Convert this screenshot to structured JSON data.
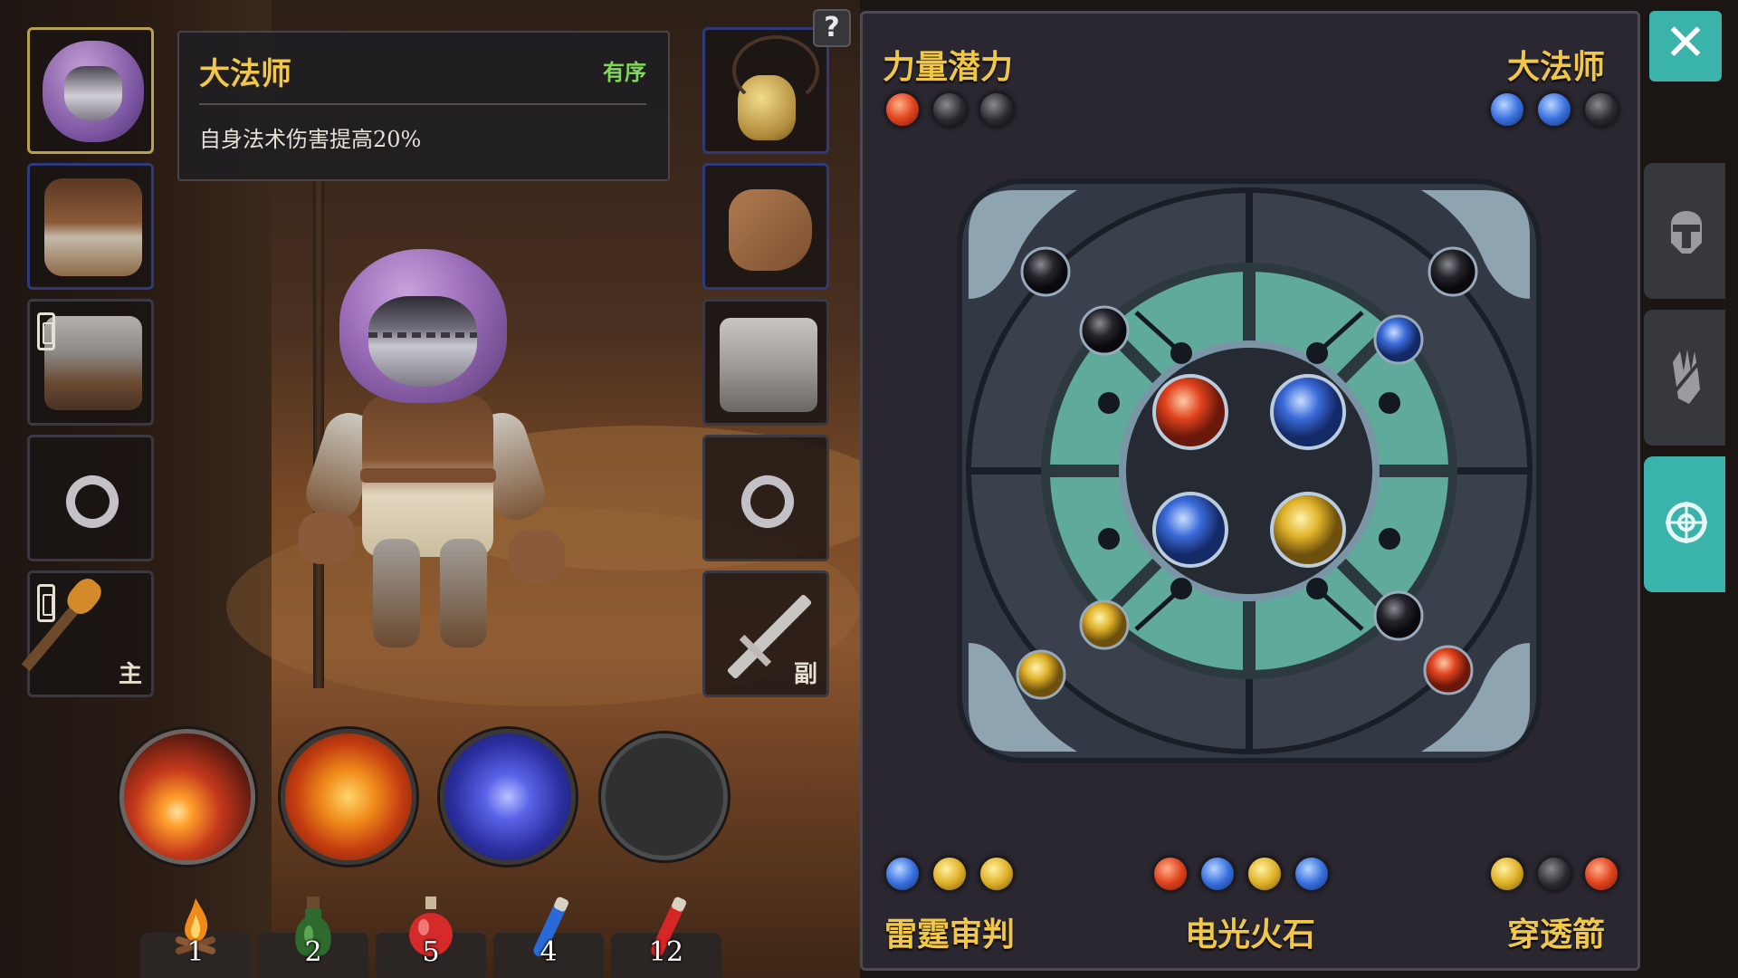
{
  "tooltip": {
    "title": "大法师",
    "tag": "有序",
    "description": "自身法术伤害提高20%"
  },
  "help": {
    "label": "?"
  },
  "equipment": {
    "left": [
      {
        "name": "hood",
        "mark": ""
      },
      {
        "name": "armor",
        "mark": ""
      },
      {
        "name": "leggings",
        "mark": ""
      },
      {
        "name": "ring",
        "mark": ""
      },
      {
        "name": "torch-weapon",
        "mark": "主"
      }
    ],
    "right": [
      {
        "name": "amulet",
        "mark": ""
      },
      {
        "name": "gloves",
        "mark": ""
      },
      {
        "name": "boots",
        "mark": ""
      },
      {
        "name": "ring",
        "mark": ""
      },
      {
        "name": "sword",
        "mark": "副"
      }
    ]
  },
  "skills": [
    "meteor-icon",
    "fire-burst-icon",
    "lightning-orb-icon",
    "empty-skill-slot"
  ],
  "consumables": [
    {
      "icon": "campfire-icon",
      "count": "1"
    },
    {
      "icon": "green-potion-icon",
      "count": "2"
    },
    {
      "icon": "red-potion-icon",
      "count": "5"
    },
    {
      "icon": "blue-vial-icon",
      "count": "4"
    },
    {
      "icon": "red-vial-icon",
      "count": "12"
    }
  ],
  "panel": {
    "title_left": "力量潜力",
    "title_right": "大法师",
    "top_left_gems": [
      "red",
      "black",
      "black"
    ],
    "top_right_gems": [
      "blue",
      "blue",
      "black"
    ],
    "footer": [
      {
        "title": "雷霆审判",
        "gems": [
          "blue",
          "gold",
          "gold"
        ]
      },
      {
        "title": "电光火石",
        "gems": [
          "red",
          "blue",
          "gold",
          "blue"
        ]
      },
      {
        "title": "穿透箭",
        "gems": [
          "gold",
          "black",
          "red"
        ]
      }
    ]
  },
  "side_tabs": [
    "helmet-icon",
    "gloves-icon",
    "gem-board-icon"
  ],
  "close": {
    "label": "✕"
  },
  "colors": {
    "accent": "#3ab3aa",
    "title_gold": "#f1c74a",
    "tag_green": "#7ed957"
  }
}
